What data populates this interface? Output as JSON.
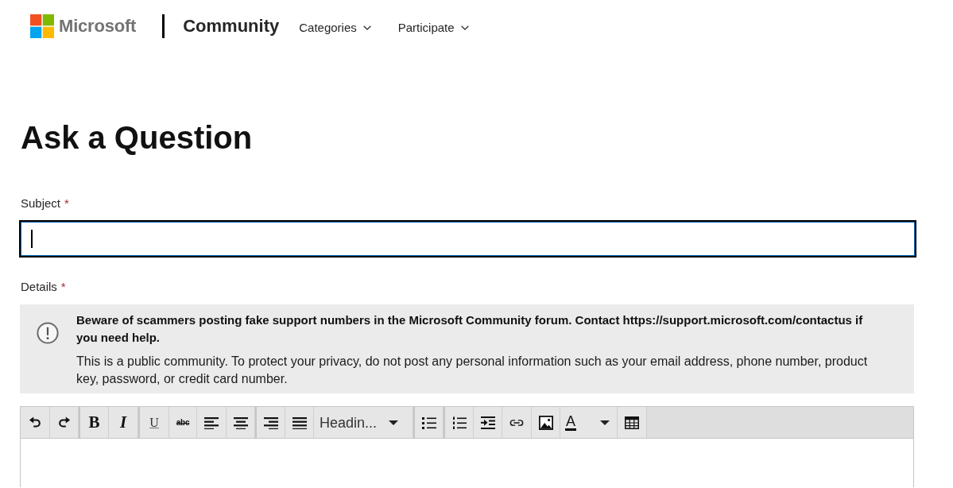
{
  "header": {
    "logo_text": "Microsoft",
    "site_title": "Community",
    "nav": [
      {
        "label": "Categories"
      },
      {
        "label": "Participate"
      }
    ]
  },
  "page_title": "Ask a Question",
  "subject": {
    "label": "Subject",
    "required_mark": "*",
    "focused": true
  },
  "details": {
    "label": "Details",
    "required_mark": "*"
  },
  "notice": {
    "title": "Beware of scammers posting fake support numbers in the Microsoft Community forum. Contact https://support.microsoft.com/contactus if you need help.",
    "body": "This is a public community. To protect your privacy, do not post any personal information such as your email address, phone number, product key, password, or credit card number."
  },
  "toolbar": {
    "groups": [
      [
        {
          "kind": "undo"
        },
        {
          "kind": "redo"
        }
      ],
      [
        {
          "kind": "bold",
          "label": "B"
        },
        {
          "kind": "italic",
          "label": "I"
        }
      ],
      [
        {
          "kind": "underline",
          "label": "U"
        },
        {
          "kind": "strike",
          "label": "abc"
        },
        {
          "kind": "left"
        },
        {
          "kind": "center"
        }
      ],
      [
        {
          "kind": "right"
        },
        {
          "kind": "justify"
        },
        {
          "kind": "heading",
          "label": "Headin..."
        }
      ],
      [
        {
          "kind": "bullets"
        }
      ],
      [
        {
          "kind": "numbers"
        },
        {
          "kind": "indent"
        },
        {
          "kind": "link"
        },
        {
          "kind": "image"
        },
        {
          "kind": "color",
          "label": "A"
        },
        {
          "kind": "table"
        }
      ]
    ]
  }
}
